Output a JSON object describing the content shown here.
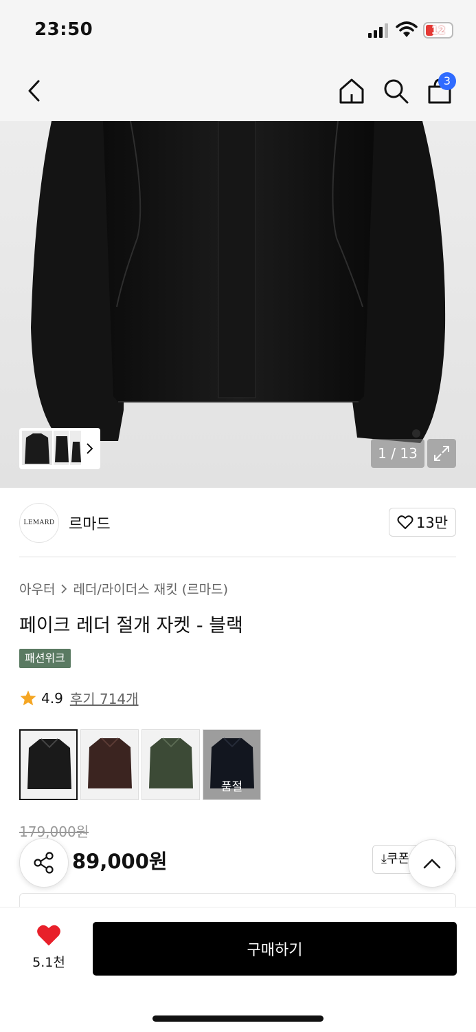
{
  "status_bar": {
    "time": "23:50",
    "battery": "12"
  },
  "nav": {
    "cart_count": "3",
    "icons": [
      "back-icon",
      "home-icon",
      "search-icon",
      "cart-icon"
    ]
  },
  "gallery": {
    "counter": "1 / 13"
  },
  "brand": {
    "logo_text": "LEMARD",
    "name": "르마드",
    "likes": "13만"
  },
  "product": {
    "breadcrumb": [
      "아우터",
      "레더/라이더스 재킷 (르마드)"
    ],
    "title": "페이크 레더 절개 자켓 - 블랙",
    "tag": "패션위크",
    "rating": "4.9",
    "reviews": "후기 714개",
    "colors": [
      {
        "name": "black",
        "hex": "#1a1a1a"
      },
      {
        "name": "brown",
        "hex": "#3b2420"
      },
      {
        "name": "khaki",
        "hex": "#3c4a36"
      },
      {
        "name": "navy",
        "hex": "#1c2230",
        "sold_out": "품절"
      }
    ],
    "original_price": "179,000원",
    "price": "89,000원",
    "coupon": "쿠폰"
  },
  "bottom": {
    "wish_count": "5.1천",
    "buy_label": "구매하기"
  },
  "colors": {
    "accent": "#2f6bff",
    "heart": "#e8202a",
    "tag_bg": "#5a7a62",
    "buy_bg": "#000000"
  }
}
